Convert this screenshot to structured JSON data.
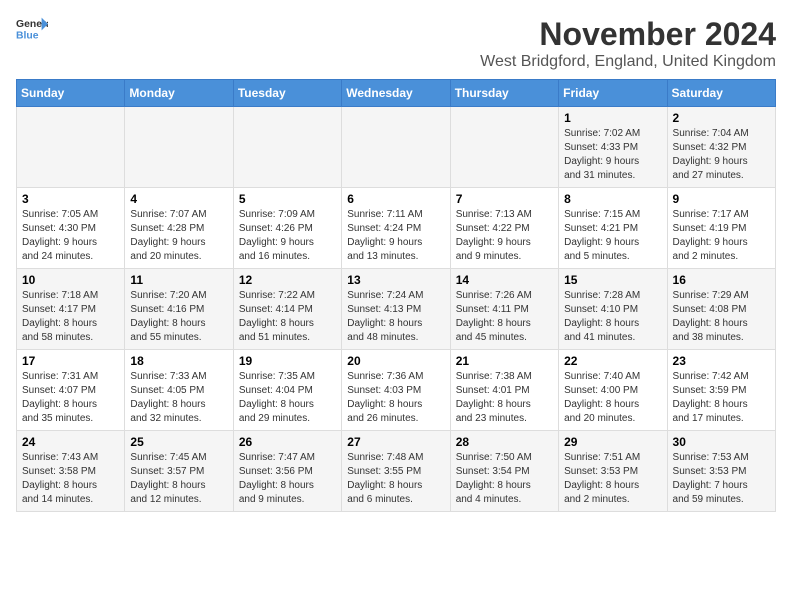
{
  "logo": {
    "general": "General",
    "blue": "Blue"
  },
  "title": "November 2024",
  "subtitle": "West Bridgford, England, United Kingdom",
  "days_header": [
    "Sunday",
    "Monday",
    "Tuesday",
    "Wednesday",
    "Thursday",
    "Friday",
    "Saturday"
  ],
  "weeks": [
    [
      {
        "day": "",
        "info": ""
      },
      {
        "day": "",
        "info": ""
      },
      {
        "day": "",
        "info": ""
      },
      {
        "day": "",
        "info": ""
      },
      {
        "day": "",
        "info": ""
      },
      {
        "day": "1",
        "info": "Sunrise: 7:02 AM\nSunset: 4:33 PM\nDaylight: 9 hours\nand 31 minutes."
      },
      {
        "day": "2",
        "info": "Sunrise: 7:04 AM\nSunset: 4:32 PM\nDaylight: 9 hours\nand 27 minutes."
      }
    ],
    [
      {
        "day": "3",
        "info": "Sunrise: 7:05 AM\nSunset: 4:30 PM\nDaylight: 9 hours\nand 24 minutes."
      },
      {
        "day": "4",
        "info": "Sunrise: 7:07 AM\nSunset: 4:28 PM\nDaylight: 9 hours\nand 20 minutes."
      },
      {
        "day": "5",
        "info": "Sunrise: 7:09 AM\nSunset: 4:26 PM\nDaylight: 9 hours\nand 16 minutes."
      },
      {
        "day": "6",
        "info": "Sunrise: 7:11 AM\nSunset: 4:24 PM\nDaylight: 9 hours\nand 13 minutes."
      },
      {
        "day": "7",
        "info": "Sunrise: 7:13 AM\nSunset: 4:22 PM\nDaylight: 9 hours\nand 9 minutes."
      },
      {
        "day": "8",
        "info": "Sunrise: 7:15 AM\nSunset: 4:21 PM\nDaylight: 9 hours\nand 5 minutes."
      },
      {
        "day": "9",
        "info": "Sunrise: 7:17 AM\nSunset: 4:19 PM\nDaylight: 9 hours\nand 2 minutes."
      }
    ],
    [
      {
        "day": "10",
        "info": "Sunrise: 7:18 AM\nSunset: 4:17 PM\nDaylight: 8 hours\nand 58 minutes."
      },
      {
        "day": "11",
        "info": "Sunrise: 7:20 AM\nSunset: 4:16 PM\nDaylight: 8 hours\nand 55 minutes."
      },
      {
        "day": "12",
        "info": "Sunrise: 7:22 AM\nSunset: 4:14 PM\nDaylight: 8 hours\nand 51 minutes."
      },
      {
        "day": "13",
        "info": "Sunrise: 7:24 AM\nSunset: 4:13 PM\nDaylight: 8 hours\nand 48 minutes."
      },
      {
        "day": "14",
        "info": "Sunrise: 7:26 AM\nSunset: 4:11 PM\nDaylight: 8 hours\nand 45 minutes."
      },
      {
        "day": "15",
        "info": "Sunrise: 7:28 AM\nSunset: 4:10 PM\nDaylight: 8 hours\nand 41 minutes."
      },
      {
        "day": "16",
        "info": "Sunrise: 7:29 AM\nSunset: 4:08 PM\nDaylight: 8 hours\nand 38 minutes."
      }
    ],
    [
      {
        "day": "17",
        "info": "Sunrise: 7:31 AM\nSunset: 4:07 PM\nDaylight: 8 hours\nand 35 minutes."
      },
      {
        "day": "18",
        "info": "Sunrise: 7:33 AM\nSunset: 4:05 PM\nDaylight: 8 hours\nand 32 minutes."
      },
      {
        "day": "19",
        "info": "Sunrise: 7:35 AM\nSunset: 4:04 PM\nDaylight: 8 hours\nand 29 minutes."
      },
      {
        "day": "20",
        "info": "Sunrise: 7:36 AM\nSunset: 4:03 PM\nDaylight: 8 hours\nand 26 minutes."
      },
      {
        "day": "21",
        "info": "Sunrise: 7:38 AM\nSunset: 4:01 PM\nDaylight: 8 hours\nand 23 minutes."
      },
      {
        "day": "22",
        "info": "Sunrise: 7:40 AM\nSunset: 4:00 PM\nDaylight: 8 hours\nand 20 minutes."
      },
      {
        "day": "23",
        "info": "Sunrise: 7:42 AM\nSunset: 3:59 PM\nDaylight: 8 hours\nand 17 minutes."
      }
    ],
    [
      {
        "day": "24",
        "info": "Sunrise: 7:43 AM\nSunset: 3:58 PM\nDaylight: 8 hours\nand 14 minutes."
      },
      {
        "day": "25",
        "info": "Sunrise: 7:45 AM\nSunset: 3:57 PM\nDaylight: 8 hours\nand 12 minutes."
      },
      {
        "day": "26",
        "info": "Sunrise: 7:47 AM\nSunset: 3:56 PM\nDaylight: 8 hours\nand 9 minutes."
      },
      {
        "day": "27",
        "info": "Sunrise: 7:48 AM\nSunset: 3:55 PM\nDaylight: 8 hours\nand 6 minutes."
      },
      {
        "day": "28",
        "info": "Sunrise: 7:50 AM\nSunset: 3:54 PM\nDaylight: 8 hours\nand 4 minutes."
      },
      {
        "day": "29",
        "info": "Sunrise: 7:51 AM\nSunset: 3:53 PM\nDaylight: 8 hours\nand 2 minutes."
      },
      {
        "day": "30",
        "info": "Sunrise: 7:53 AM\nSunset: 3:53 PM\nDaylight: 7 hours\nand 59 minutes."
      }
    ]
  ]
}
